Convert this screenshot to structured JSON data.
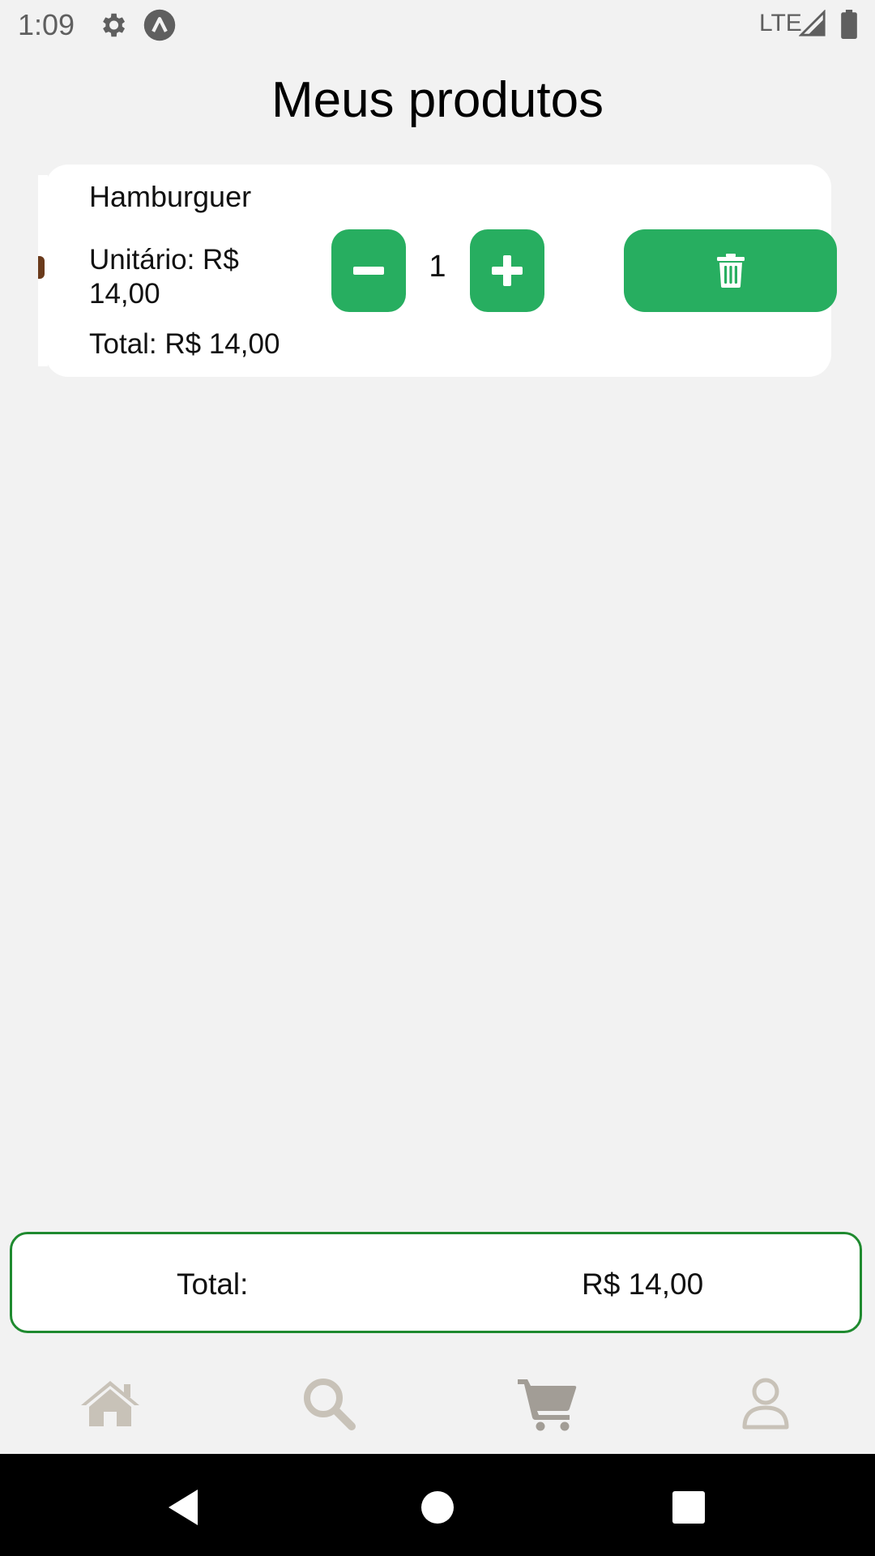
{
  "status_bar": {
    "time": "1:09",
    "network": "LTE",
    "icons": [
      "gear-icon",
      "app-indicator-icon",
      "signal-icon",
      "battery-icon"
    ]
  },
  "page": {
    "title": "Meus produtos"
  },
  "cart_items": [
    {
      "name": "Hamburguer",
      "unit_price": "Unitário: R$ 14,00",
      "line_total": "Total: R$ 14,00",
      "quantity": "1"
    }
  ],
  "summary": {
    "label": "Total:",
    "value": "R$ 14,00"
  },
  "bottom_nav": {
    "items": [
      "home-icon",
      "search-icon",
      "cart-icon",
      "profile-icon"
    ],
    "active": "cart-icon"
  },
  "colors": {
    "accent": "#27ae60",
    "border": "#1f8a2f",
    "background": "#f2f2f2",
    "nav_icon": "#c8c2b8",
    "nav_icon_active": "#a29d96"
  }
}
